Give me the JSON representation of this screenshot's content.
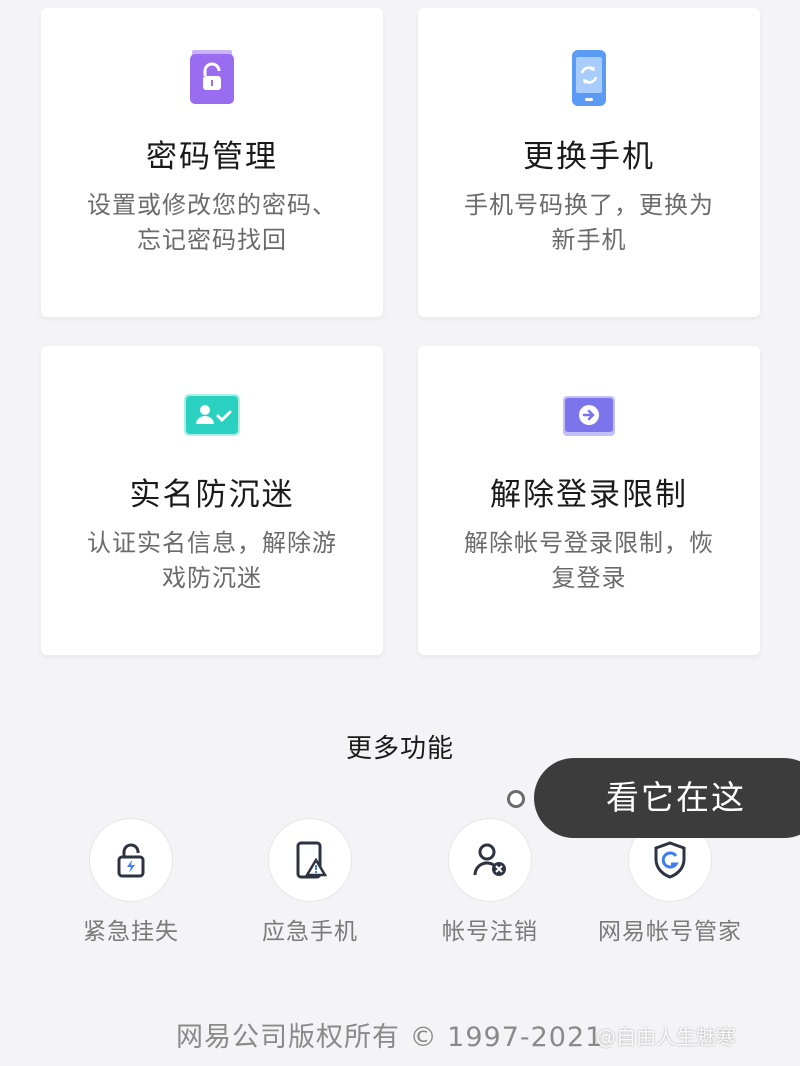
{
  "cards": [
    {
      "title": "密码管理",
      "desc_line1": "设置或修改您的密码、",
      "desc_line2": "忘记密码找回",
      "icon": "lock-clipboard-icon"
    },
    {
      "title": "更换手机",
      "desc_line1": "手机号码换了，更换为",
      "desc_line2": "新手机",
      "icon": "phone-refresh-icon"
    },
    {
      "title": "实名防沉迷",
      "desc_line1": "认证实名信息，解除游",
      "desc_line2": "戏防沉迷",
      "icon": "id-card-check-icon"
    },
    {
      "title": "解除登录限制",
      "desc_line1": "解除帐号登录限制，恢",
      "desc_line2": "复登录",
      "icon": "arrow-circle-icon"
    }
  ],
  "more": {
    "title": "更多功能",
    "items": [
      {
        "label": "紧急挂失",
        "icon": "lock-bolt-icon"
      },
      {
        "label": "应急手机",
        "icon": "phone-warning-icon"
      },
      {
        "label": "帐号注销",
        "icon": "user-remove-icon"
      },
      {
        "label": "网易帐号管家",
        "icon": "shield-g-icon"
      }
    ]
  },
  "tooltip": {
    "text": "看它在这"
  },
  "footer": {
    "copyright": "网易公司版权所有 © 1997-2021"
  },
  "watermark": {
    "text": "@自由人生魅寒"
  },
  "colors": {
    "purple": "#9a6cf0",
    "blue": "#5b9bf5",
    "teal": "#2ad1c0",
    "indigo": "#7b74ea",
    "icon_dark": "#2d3340",
    "icon_accent": "#3f7ef0"
  }
}
